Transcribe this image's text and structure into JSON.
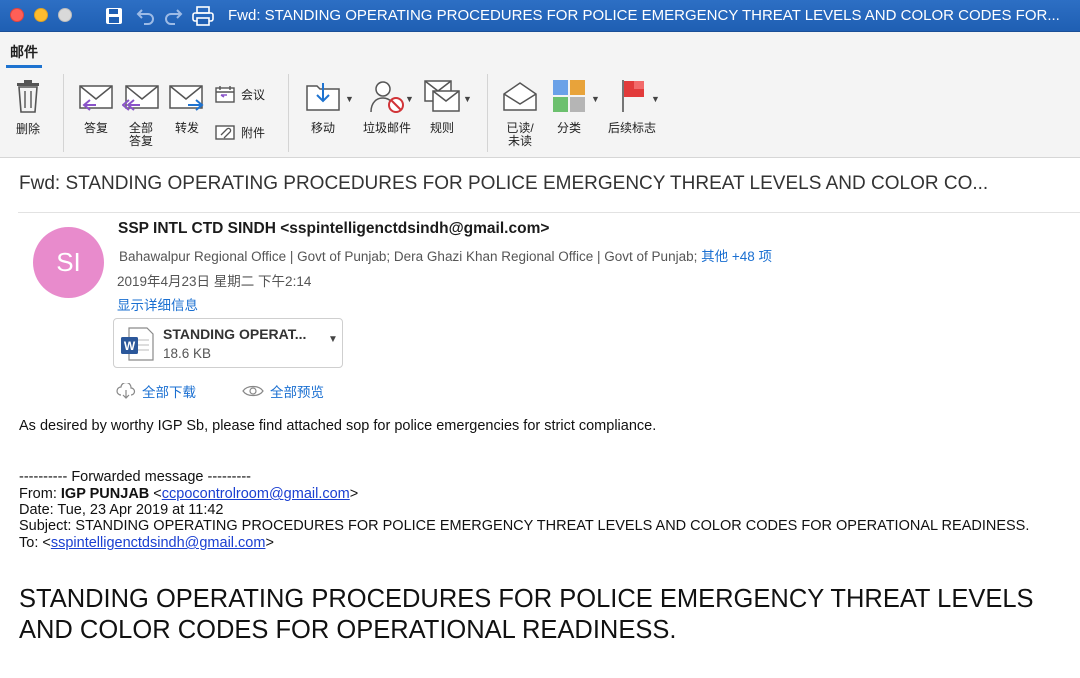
{
  "window": {
    "title": "Fwd: STANDING OPERATING PROCEDURES FOR POLICE EMERGENCY THREAT LEVELS AND COLOR CODES FOR..."
  },
  "ribbon": {
    "tab": "邮件",
    "delete": "删除",
    "reply": "答复",
    "reply_all_line1": "全部",
    "reply_all_line2": "答复",
    "forward": "转发",
    "meeting": "会议",
    "attachment": "附件",
    "move": "移动",
    "junk": "垃圾邮件",
    "rules": "规则",
    "read_line1": "已读/",
    "read_line2": "未读",
    "categorize": "分类",
    "follow_up": "后续标志"
  },
  "message": {
    "subject": "Fwd: STANDING OPERATING PROCEDURES FOR POLICE EMERGENCY THREAT LEVELS AND COLOR CO...",
    "avatar_initials": "SI",
    "sender": "SSP INTL CTD SINDH <sspintelligenctdsindh@gmail.com>",
    "recipients": "Bahawalpur Regional Office | Govt of Punjab;   Dera Ghazi Khan Regional Office | Govt of Punjab;",
    "recipients_more": "其他 +48 项",
    "date": "2019年4月23日 星期二 下午2:14",
    "show_details": "显示详细信息",
    "attachment": {
      "name": "STANDING OPERAT...",
      "size": "18.6 KB"
    },
    "download_all": "全部下载",
    "preview_all": "全部预览"
  },
  "body": {
    "intro": "As desired by worthy IGP Sb, please find attached sop for police emergencies for strict compliance.",
    "fwd_header": "---------- Forwarded message ---------",
    "from_label": "From: ",
    "from_name": "IGP PUNJAB",
    "from_email": "ccpocontrolroom@gmail.com",
    "date_line": "Date: Tue, 23 Apr 2019 at 11:42",
    "subject_line": "Subject: STANDING OPERATING PROCEDURES FOR POLICE EMERGENCY THREAT LEVELS AND COLOR CODES FOR OPERATIONAL READINESS.",
    "to_label": "To: ",
    "to_email": "sspintelligenctdsindh@gmail.com",
    "heading": "STANDING OPERATING PROCEDURES FOR POLICE EMERGENCY THREAT LEVELS AND COLOR CODES FOR OPERATIONAL READINESS."
  },
  "colors": {
    "titlebar": "#1f5fb3",
    "accent": "#1a6fd1",
    "avatar": "#e88bcc"
  }
}
